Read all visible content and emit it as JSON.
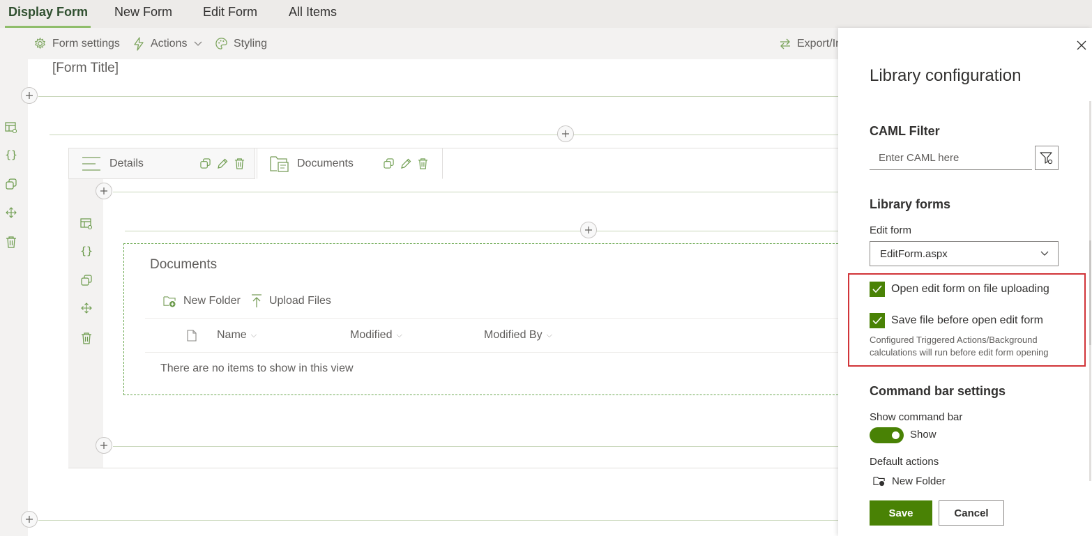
{
  "top_tabs": [
    {
      "label": "Display Form",
      "active": true
    },
    {
      "label": "New Form",
      "active": false
    },
    {
      "label": "Edit Form",
      "active": false
    },
    {
      "label": "All Items",
      "active": false
    }
  ],
  "toolbar": {
    "form_settings": "Form settings",
    "actions": "Actions",
    "styling": "Styling",
    "export_import": "Export/In"
  },
  "form": {
    "title": "[Form Title]",
    "tabs": [
      {
        "label": "Details",
        "active": false
      },
      {
        "label": "Documents",
        "active": true
      }
    ],
    "documents": {
      "title": "Documents",
      "new_folder": "New Folder",
      "upload_files": "Upload Files",
      "columns": [
        "Name",
        "Modified",
        "Modified By"
      ],
      "empty_message": "There are no items to show in this view"
    }
  },
  "panel": {
    "title": "Library configuration",
    "caml_heading": "CAML Filter",
    "caml_placeholder": "Enter CAML here",
    "library_forms_heading": "Library forms",
    "edit_form_label": "Edit form",
    "edit_form_value": "EditForm.aspx",
    "open_edit_form_label": "Open edit form on file uploading",
    "open_edit_form_checked": true,
    "save_file_label": "Save file before open edit form",
    "save_file_checked": true,
    "note": "Configured Triggered Actions/Background calculations will run before edit form opening",
    "command_bar_heading": "Command bar settings",
    "show_command_bar_label": "Show command bar",
    "show_command_bar_state": "Show",
    "show_command_bar_on": true,
    "default_actions_label": "Default actions",
    "default_action_item": "New Folder",
    "save_button": "Save",
    "cancel_button": "Cancel"
  },
  "colors": {
    "accent": "#498205",
    "highlight_border": "#d13438",
    "dashed_border": "#6aa84f"
  }
}
